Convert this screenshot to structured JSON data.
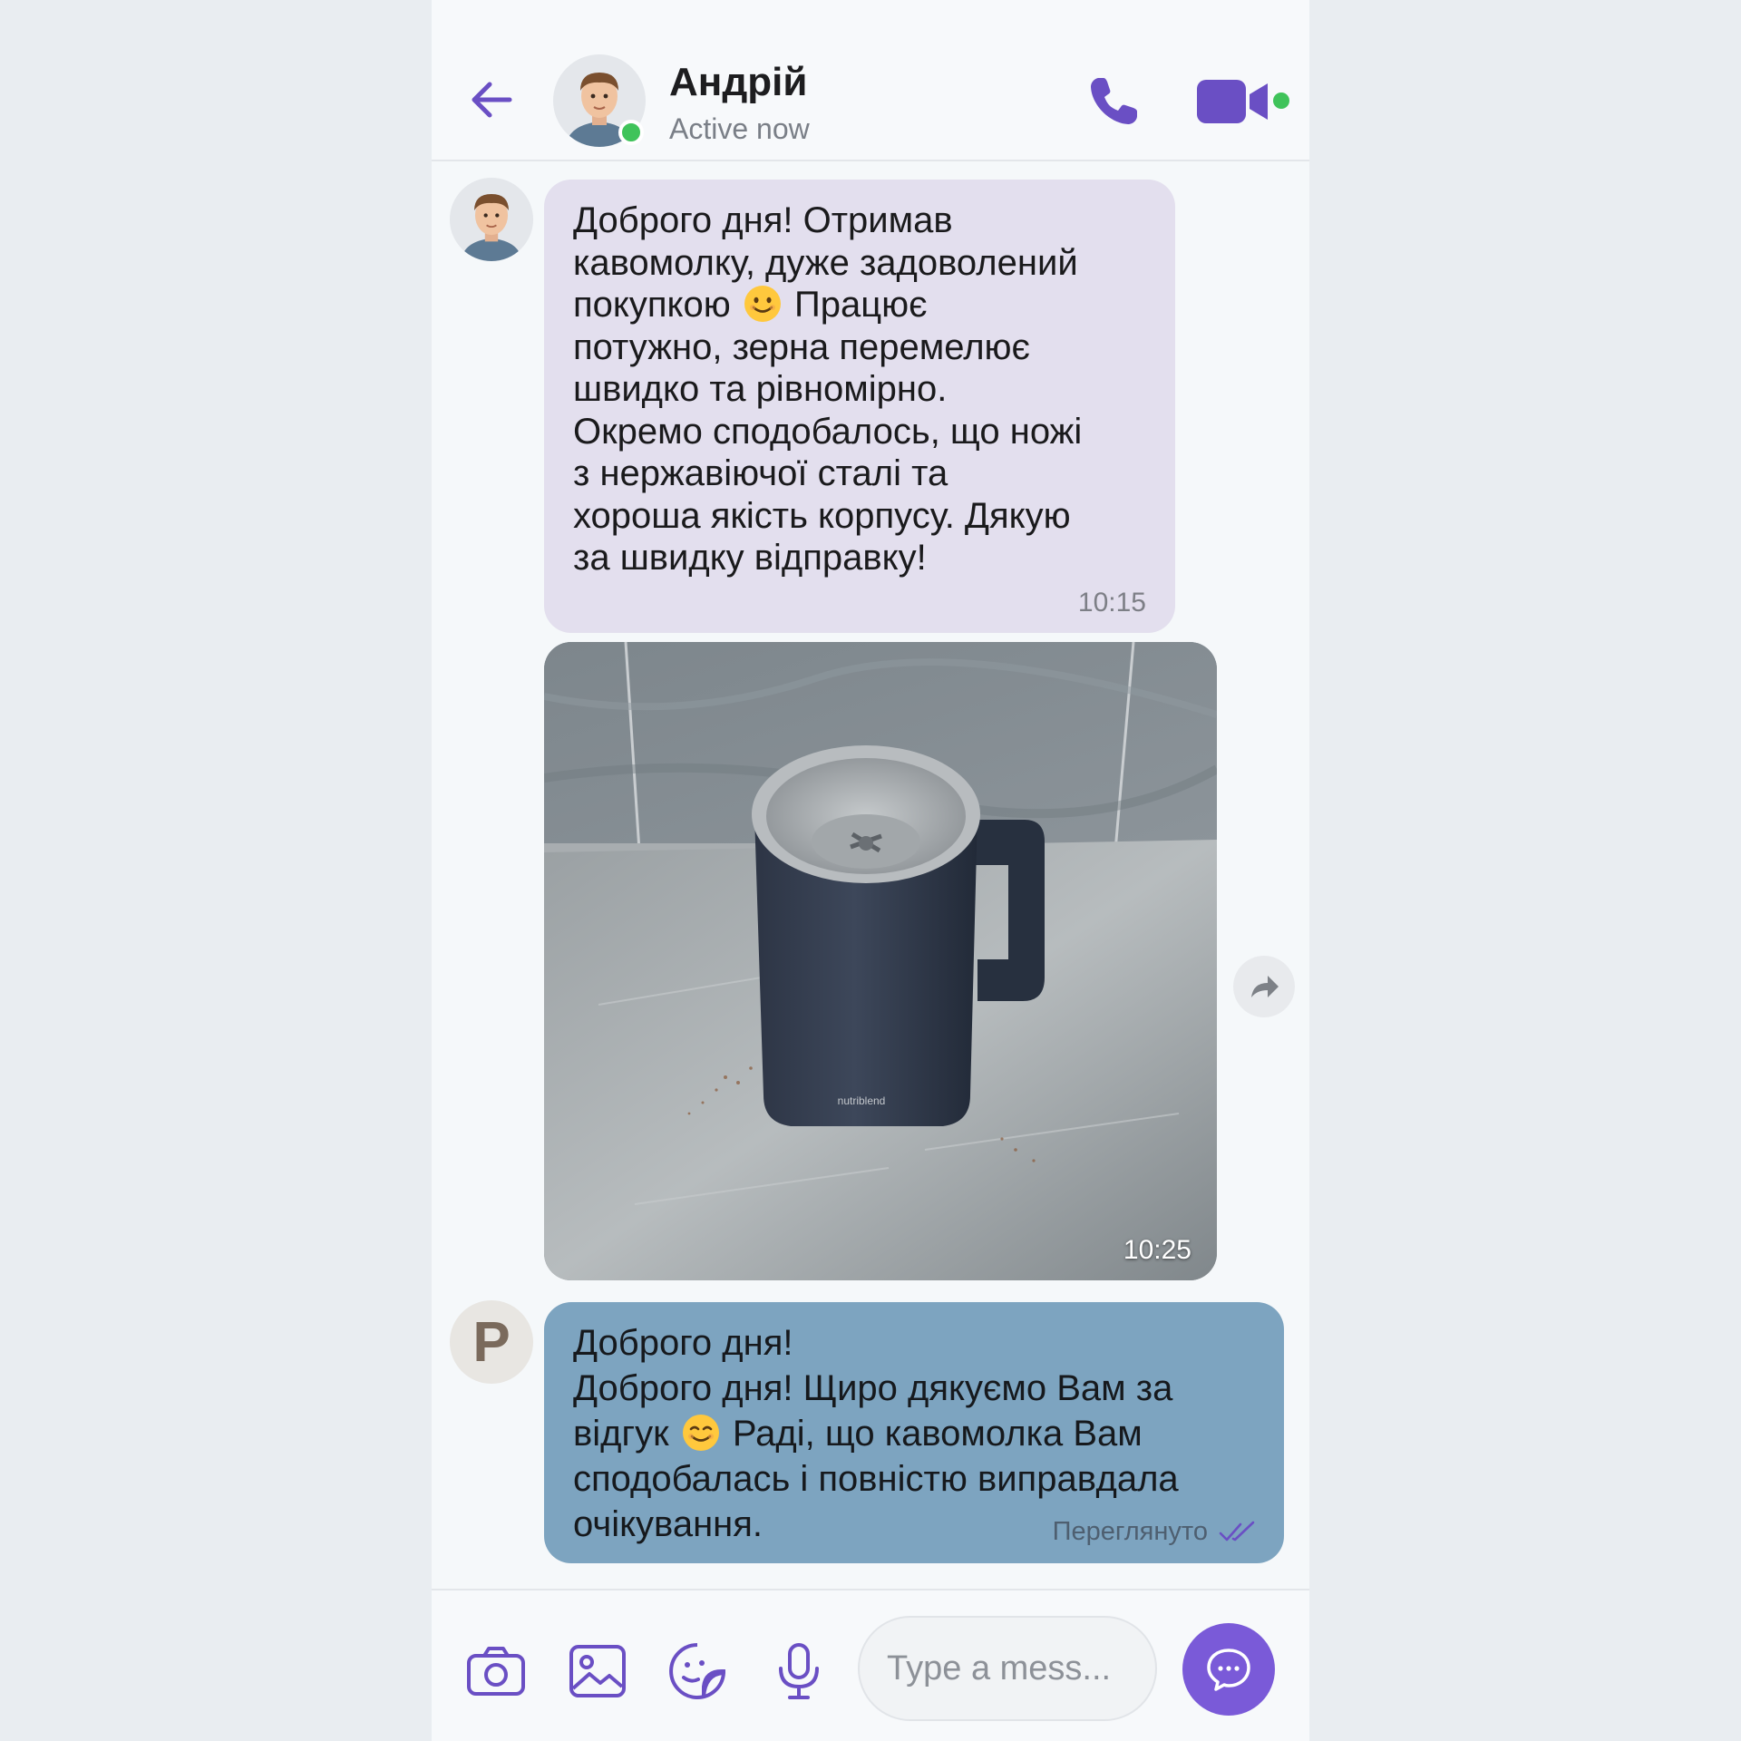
{
  "header": {
    "contact_name": "Андрій",
    "status": "Active now",
    "icons": [
      "back-arrow-icon",
      "phone-icon",
      "video-camera-icon"
    ]
  },
  "messages": [
    {
      "direction": "incoming",
      "text_part1": "Доброго дня! Отримав\nкавомолку, дуже задоволений\nпокупкою",
      "text_part2": "Працює\nпотужно, зерна перемелює\nшвидко та рівномірно.\nОкремо сподобалось, що ножі\nз нержавіючої сталі та\nхороша якість корпусу. Дякую\nза швидку відправку!",
      "time": "10:15"
    },
    {
      "direction": "incoming",
      "type": "photo",
      "photo_caption_brand": "nutriblend",
      "time": "10:25"
    },
    {
      "direction": "outgoing",
      "sender_initial": "P",
      "text_part1": "Доброго дня!\nДоброго дня! Щиро дякуємо Вам за\nвідгук",
      "text_part2": "Раді, що кавомолка Вам\nсподобалась і повністю виправдала\nочікування.",
      "status": "Переглянуто"
    }
  ],
  "composer": {
    "placeholder": "Type a mess...",
    "icons": [
      "camera-icon",
      "gallery-icon",
      "sticker-icon",
      "microphone-icon",
      "send-icon"
    ]
  },
  "colors": {
    "accent": "#7a5ad8",
    "incoming_bubble": "#e3dfee",
    "outgoing_bubble": "#7da4c0",
    "online": "#3fc35a"
  }
}
